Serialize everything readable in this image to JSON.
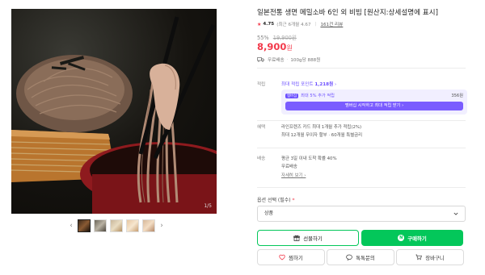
{
  "product": {
    "title": "일본전통 생면 메밀소바 6인 외 비빔 [원산지:상세설명에 표시]",
    "rating_score": "4.75",
    "rating_recent": "(최근 6개월 4.67",
    "reviews_link": "161건 리뷰",
    "discount_rate": "55%",
    "original_price": "19,900원",
    "price_number": "8,900",
    "price_unit": "원",
    "shipping_free": "무료배송",
    "shipping_detail": "100g당 888원"
  },
  "gallery": {
    "counter": "1/5",
    "prev_icon": "chevron-left-icon",
    "next_icon": "chevron-right-icon"
  },
  "points": {
    "label": "적립",
    "max_text": "최대 적립 포인트",
    "max_amount": "1,218원",
    "promo_badge": "멤버십",
    "promo_text": "최대 5% 추가 적립",
    "promo_amount": "356원",
    "promo_button": "멤버십 시작하고 최대 적립 받기"
  },
  "benefit": {
    "label": "혜택",
    "line1": "라인프렌즈 카드 최대 1개월 추가 적립(2%)",
    "line2": "최대 12개월 무이자 할부 · 60개월 특별금리"
  },
  "delivery": {
    "label": "배송",
    "line1": "평균 3일 이내 도착 확률 40%",
    "line2": "무료배송",
    "detail_link": "자세히 보기"
  },
  "option": {
    "label": "옵션 선택 (필수)",
    "required_mark": "*",
    "selected": "상품"
  },
  "actions": {
    "gift_label": "선물하기",
    "buy_label": "구매하기",
    "wish_label": "찜하기",
    "talk_label": "톡톡문의",
    "cart_label": "장바구니"
  },
  "colors": {
    "accent_red": "#f2394a",
    "naver_green": "#03c75a",
    "membership_purple": "#6b4eff"
  }
}
